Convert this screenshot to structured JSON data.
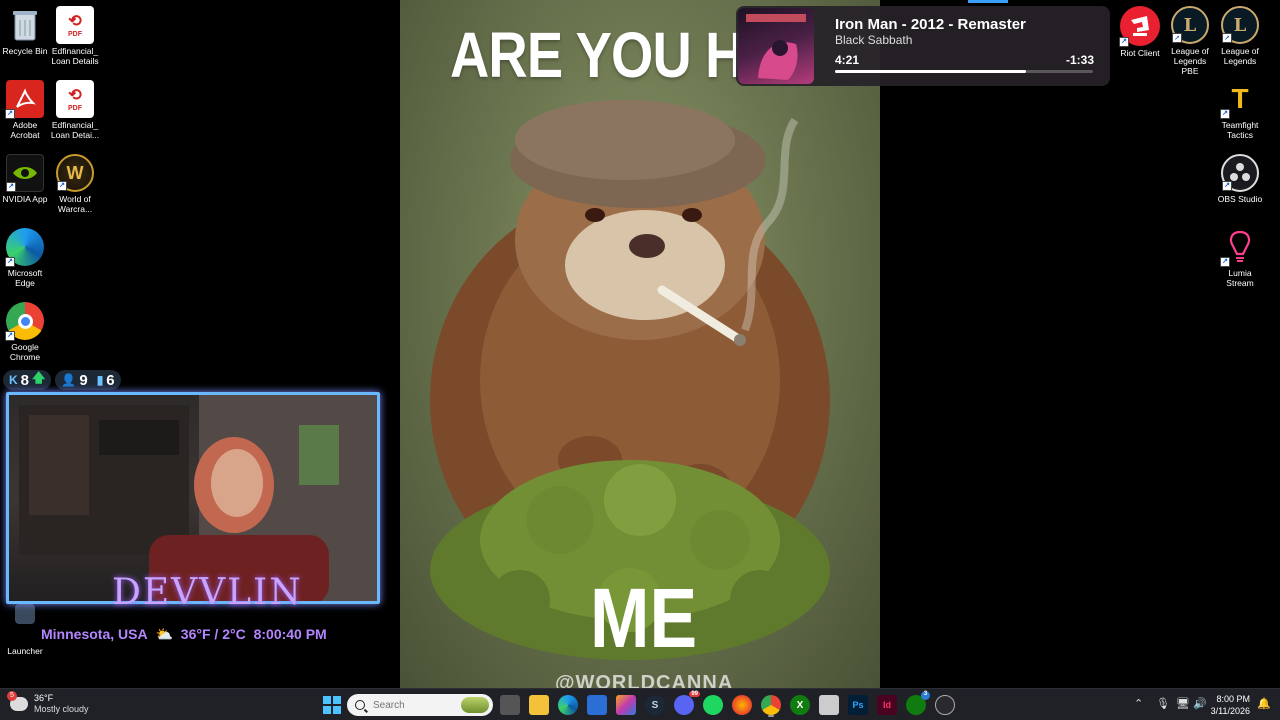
{
  "desktop": {
    "left_icons": [
      {
        "label": "Recycle Bin",
        "icon": "recycle-bin-icon"
      },
      {
        "label": "Edfinancial_ Loan Details",
        "icon": "pdf-icon"
      },
      {
        "label": "Adobe Acrobat",
        "icon": "adobe-acrobat-icon"
      },
      {
        "label": "Edfinancial_ Loan Detai...",
        "icon": "pdf-icon"
      },
      {
        "label": "NVIDIA App",
        "icon": "nvidia-icon"
      },
      {
        "label": "World of Warcra...",
        "icon": "world-of-warcraft-icon"
      },
      {
        "label": "Microsoft Edge",
        "icon": "edge-icon"
      },
      {
        "label": "Google Chrome",
        "icon": "chrome-icon"
      },
      {
        "label": "Launcher",
        "icon": "launcher-icon"
      }
    ],
    "right_icons": [
      {
        "label": "Riot Client",
        "icon": "riot-client-icon"
      },
      {
        "label": "League of Legends PBE",
        "icon": "league-pbe-icon"
      },
      {
        "label": "League of Legends",
        "icon": "league-icon"
      },
      {
        "label": "Teamfight Tactics",
        "icon": "tft-icon"
      },
      {
        "label": "OBS Studio",
        "icon": "obs-icon"
      },
      {
        "label": "Lumia Stream",
        "icon": "lumia-icon"
      }
    ]
  },
  "wallpaper": {
    "top_text": "ARE YOU HIG",
    "bottom_text": "ME",
    "credit": "@WORLDCANNA"
  },
  "media": {
    "title": "Iron Man - 2012 - Remaster",
    "artist": "Black Sabbath",
    "elapsed": "4:21",
    "remaining": "-1:33",
    "progress_fraction": 0.74
  },
  "stream_overlay": {
    "stats": [
      {
        "icon": "kick-icon",
        "value": "8",
        "trend": "up"
      },
      {
        "icon": "viewer-icon",
        "value": "9"
      },
      {
        "icon": "bars-icon",
        "value": "6"
      }
    ],
    "name": "DEVVLIN",
    "location": "Minnesota, USA",
    "temperature": "36°F / 2°C",
    "time": "8:00:40 PM"
  },
  "taskbar": {
    "weather_temp": "36°F",
    "weather_desc": "Mostly cloudy",
    "weather_badge": "5",
    "search_placeholder": "Search",
    "clock_time": "8:00 PM",
    "clock_date": "3/11/2026",
    "apps": [
      "start-icon",
      "search",
      "task-view-icon",
      "file-explorer-icon",
      "edge-icon",
      "store-icon",
      "copilot-icon",
      "steam-icon",
      "discord-icon",
      "spotify-icon",
      "firefox-icon",
      "chrome-icon",
      "xbox-icon",
      "snipping-icon",
      "photoshop-icon",
      "indesign-icon",
      "xbox-app-icon",
      "obs-icon"
    ],
    "discord_badge": "99",
    "xbox_badge": "3"
  }
}
